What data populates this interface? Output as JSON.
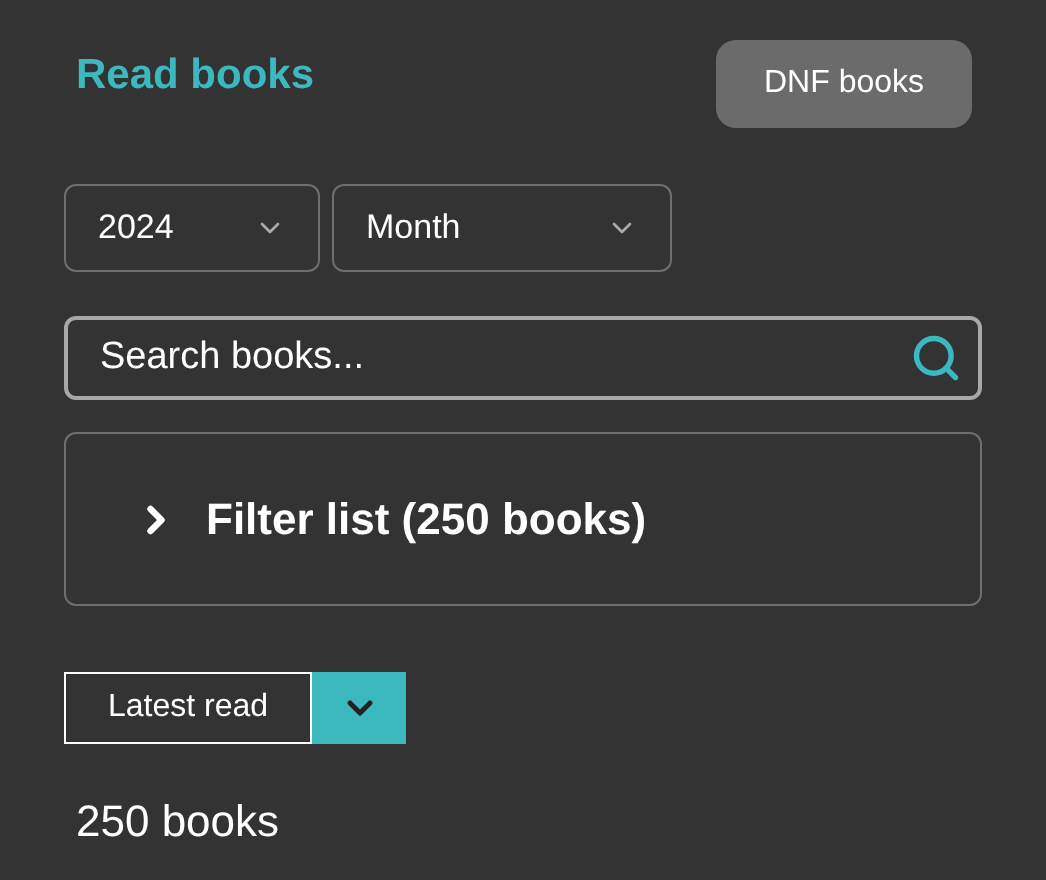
{
  "header": {
    "title": "Read books",
    "dnf_button": "DNF books"
  },
  "filters": [
    {
      "value": "2024"
    },
    {
      "value": "Month"
    }
  ],
  "search": {
    "placeholder": "Search books..."
  },
  "filter_list": {
    "label": "Filter list (250 books)",
    "expanded": false
  },
  "sort": {
    "label": "Latest read"
  },
  "count": "250 books"
}
